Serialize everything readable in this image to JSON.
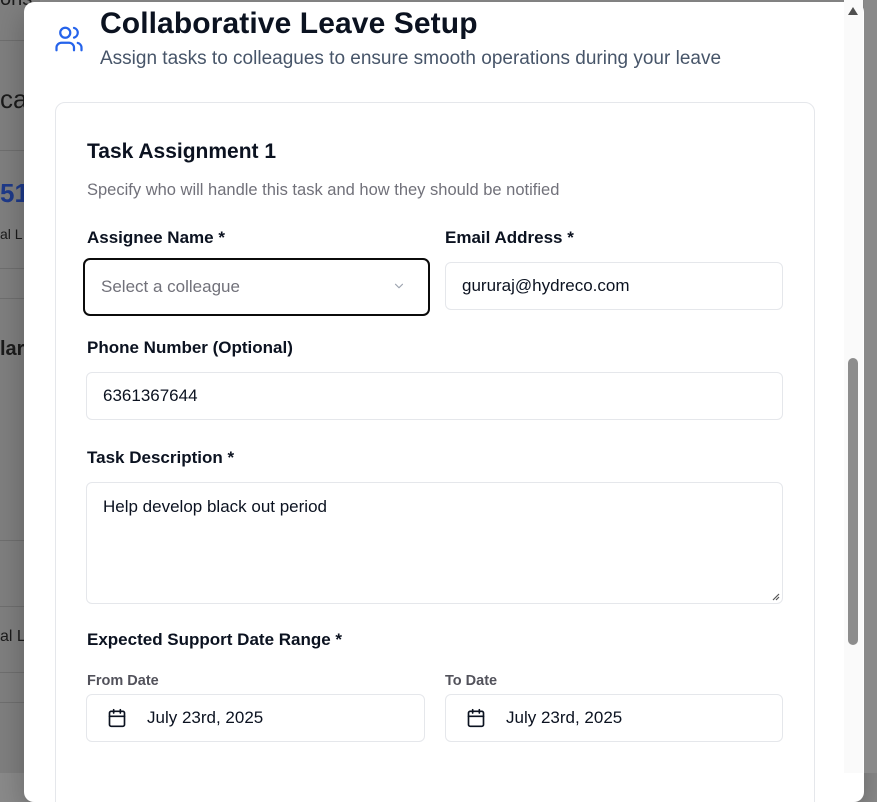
{
  "background": {
    "fragments": [
      "ons",
      "cat",
      "51",
      "al L",
      "lar",
      "al L"
    ]
  },
  "modal": {
    "title": "Collaborative Leave Setup",
    "subtitle": "Assign tasks to colleagues to ensure smooth operations during your leave",
    "header_icon": "users-icon"
  },
  "task": {
    "title": "Task Assignment 1",
    "subtitle": "Specify who will handle this task and how they should be notified",
    "assignee": {
      "label": "Assignee Name *",
      "placeholder": "Select a colleague"
    },
    "email": {
      "label": "Email Address *",
      "value": "gururaj@hydreco.com"
    },
    "phone": {
      "label": "Phone Number (Optional)",
      "value": "6361367644"
    },
    "description": {
      "label": "Task Description *",
      "value": "Help develop black out period"
    },
    "date_range": {
      "label": "Expected Support Date Range *",
      "from_label": "From Date",
      "from_value": "July 23rd, 2025",
      "to_label": "To Date",
      "to_value": "July 23rd, 2025"
    }
  },
  "colors": {
    "accent": "#2563eb",
    "focus_border": "#0b0b0b",
    "muted": "#71717a"
  }
}
